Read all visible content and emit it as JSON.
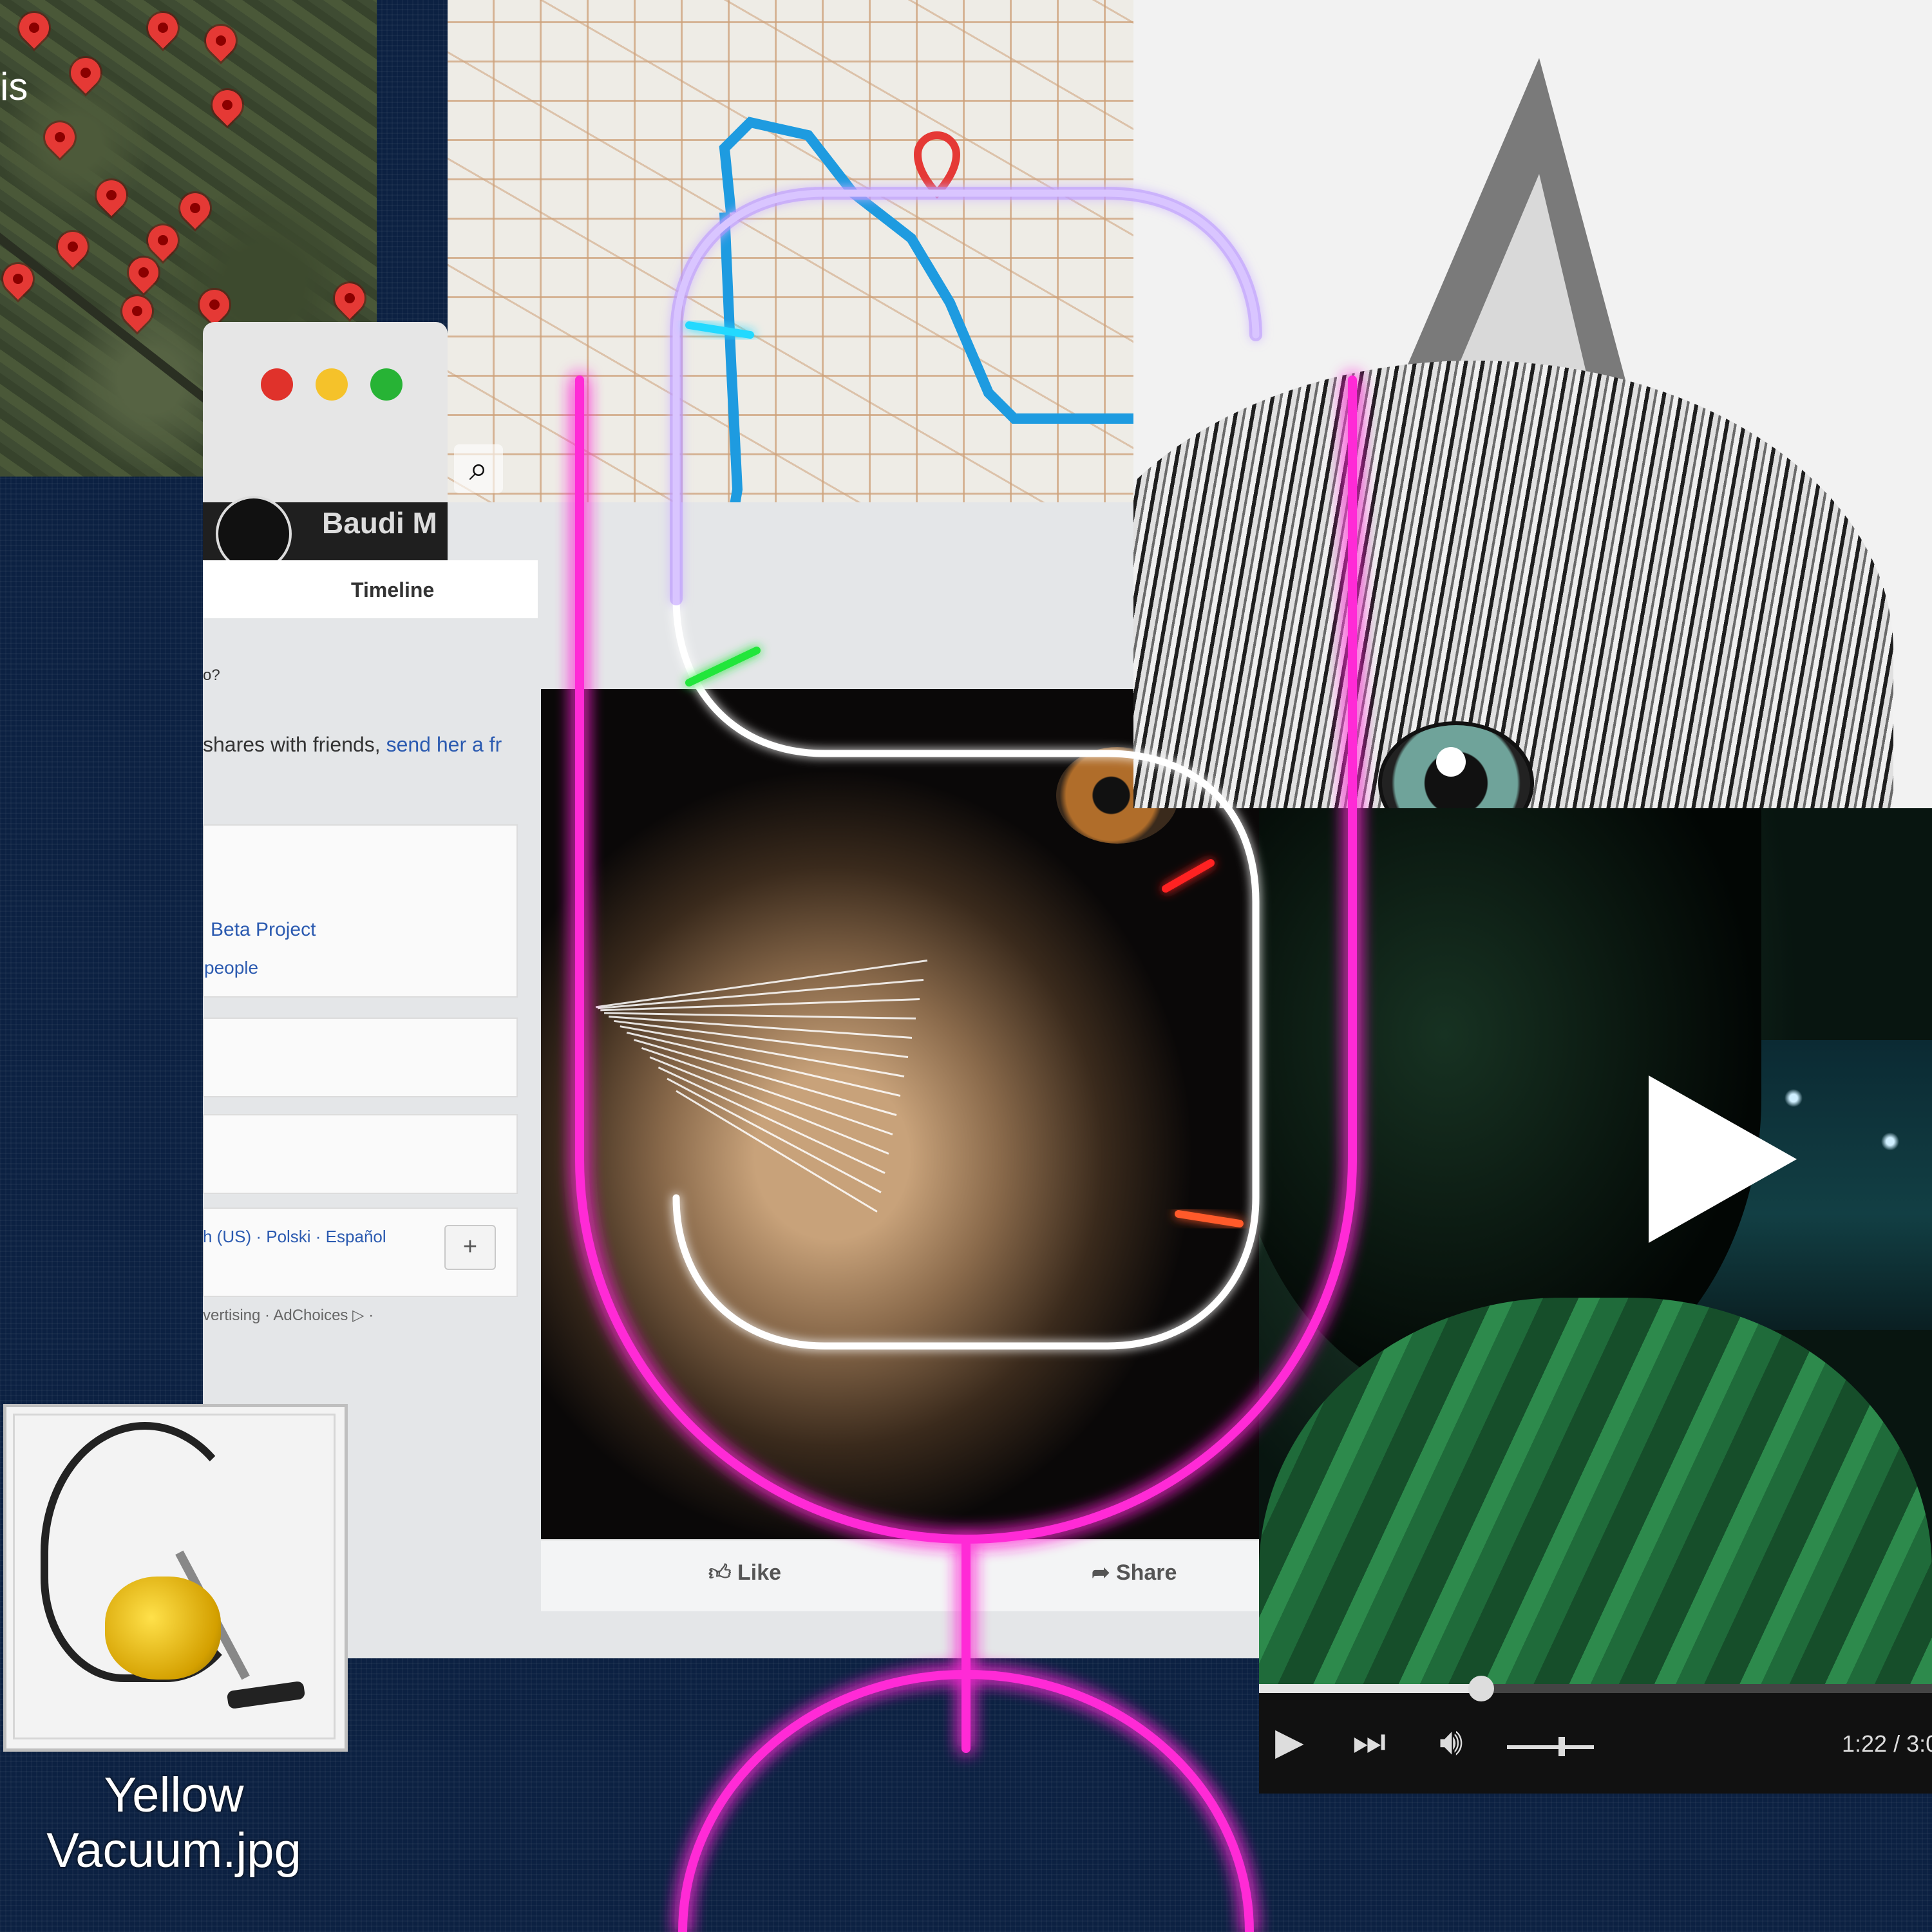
{
  "satellite_map": {
    "label": "is",
    "pin_icon": "map-pin-icon",
    "pin_color": "#e53935"
  },
  "street_map": {
    "tools": [
      "camera-search-icon",
      "compass-icon"
    ],
    "route_color": "#1e9be0"
  },
  "browser": {
    "buttons": [
      "close",
      "minimize",
      "zoom"
    ],
    "colors": [
      "#e0322b",
      "#f5c22a",
      "#27b335"
    ]
  },
  "facebook": {
    "profile_name": "Baudi M",
    "tab": "Timeline",
    "prompt": "o?",
    "share_text": "shares with friends, ",
    "share_link": "send her a fr",
    "group": "Beta Project",
    "people": "people",
    "languages": "h (US) · Polski · Español",
    "plus": "+",
    "footer": "vertising · AdChoices ▷ ·",
    "like": "Like",
    "share": "Share",
    "like_icon": "thumbs-up-icon",
    "share_icon": "share-arrow-icon"
  },
  "video_player": {
    "time": "1:22 / 3:0",
    "progress": 0.33,
    "volume": 0.6,
    "play_icon": "play-icon",
    "next_icon": "skip-next-icon",
    "volume_icon": "speaker-icon",
    "big_play_icon": "big-play-icon"
  },
  "file": {
    "name_line1": "Yellow",
    "name_line2": "Vacuum.jpg"
  },
  "logo": {
    "type": "neon-microphone-s",
    "color": "#ff2bd6",
    "accents": [
      "#ff3b2b",
      "#22e63a",
      "#ff3b2b",
      "#23d9ff",
      "#ff5a2a",
      "#ff2020",
      "#22e63a",
      "#ff3b2b",
      "#23d9ff",
      "#ff2020",
      "#22e63a",
      "#23d9ff",
      "#ff5a2a",
      "#22e63a",
      "#23d9ff",
      "#ff2020"
    ]
  }
}
